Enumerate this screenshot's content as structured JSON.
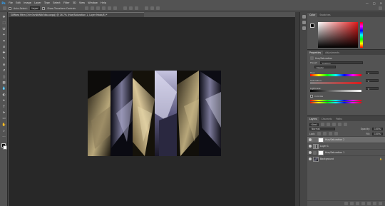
{
  "app": {
    "logo": "Ps"
  },
  "menu": [
    "File",
    "Edit",
    "Image",
    "Layer",
    "Type",
    "Select",
    "Filter",
    "3D",
    "View",
    "Window",
    "Help"
  ],
  "window_controls": {
    "minimize": "—",
    "restore": "□",
    "close": "✕"
  },
  "options_bar": {
    "auto_select_label": "Auto-Select:",
    "auto_select_value": "Layer",
    "show_transform": "Show Transform Controls"
  },
  "document": {
    "tab_title": "GIMbea Mkm (?chr?arNkWtb?dba.orgpj) @ 16.7% (Hue/Saturation 1, Layer Mask/8) *"
  },
  "tools": [
    {
      "icon": "✥",
      "name": "move-tool-icon"
    },
    {
      "icon": "⬚",
      "name": "marquee-tool-icon"
    },
    {
      "icon": "ᗢ",
      "name": "lasso-tool-icon"
    },
    {
      "icon": "✦",
      "name": "quick-select-tool-icon"
    },
    {
      "icon": "⌗",
      "name": "crop-tool-icon"
    },
    {
      "icon": "⊘",
      "name": "eyedropper-tool-icon"
    },
    {
      "icon": "✚",
      "name": "healing-tool-icon"
    },
    {
      "icon": "✎",
      "name": "brush-tool-icon"
    },
    {
      "icon": "⊕",
      "name": "clone-stamp-tool-icon"
    },
    {
      "icon": "↺",
      "name": "history-brush-tool-icon"
    },
    {
      "icon": "◻",
      "name": "eraser-tool-icon"
    },
    {
      "icon": "▦",
      "name": "gradient-tool-icon"
    },
    {
      "icon": "💧",
      "name": "blur-tool-icon"
    },
    {
      "icon": "◐",
      "name": "dodge-tool-icon"
    },
    {
      "icon": "✒",
      "name": "pen-tool-icon"
    },
    {
      "icon": "T",
      "name": "type-tool-icon"
    },
    {
      "icon": "➤",
      "name": "path-select-tool-icon"
    },
    {
      "icon": "▭",
      "name": "shape-tool-icon"
    },
    {
      "icon": "✋",
      "name": "hand-tool-icon"
    },
    {
      "icon": "⌕",
      "name": "zoom-tool-icon"
    },
    {
      "icon": "⋯",
      "name": "edit-toolbar-icon"
    }
  ],
  "color_panel": {
    "tabs": [
      "Color",
      "Swatches"
    ],
    "accent": "#e01a1a"
  },
  "properties_panel": {
    "tabs": [
      "Properties",
      "Adjustments"
    ],
    "title": "Hue/Saturation",
    "preset_label": "Preset:",
    "preset_value": "Custom",
    "channel_value": "Master",
    "hue_label": "Hue:",
    "hue_value": "0",
    "saturation_label": "Saturation:",
    "saturation_value": "0",
    "lightness_label": "Lightness:",
    "lightness_value": "0",
    "colorize_label": "Colorize"
  },
  "layers_panel": {
    "tabs": [
      "Layers",
      "Channels",
      "Paths"
    ],
    "kind_label": "Kind",
    "blend_mode": "Normal",
    "opacity_label": "Opacity:",
    "opacity_value": "100%",
    "lock_label": "Lock:",
    "fill_label": "Fill:",
    "fill_value": "100%",
    "layers": [
      {
        "name": "Hue/Saturation 2"
      },
      {
        "name": "Layer 1"
      },
      {
        "name": "Hue/Saturation 1"
      },
      {
        "name": "Background"
      }
    ]
  }
}
